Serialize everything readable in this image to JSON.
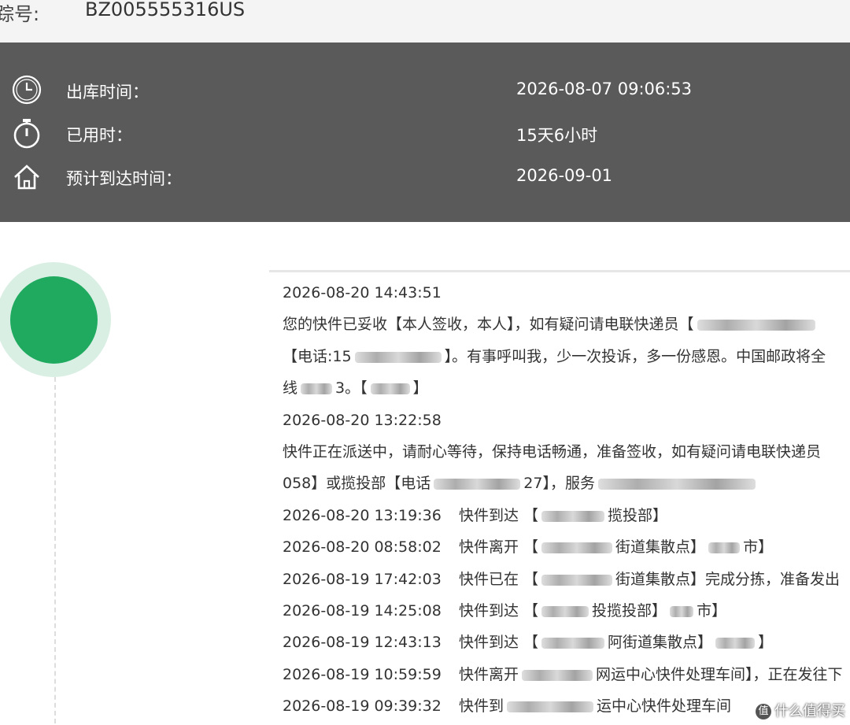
{
  "header": {
    "tracking_label": "踪号:",
    "tracking_number": "BZ005555316US"
  },
  "summary": {
    "rows": [
      {
        "icon": "clock-icon",
        "label": "出库时间：",
        "value": "2026-08-07 09:06:53"
      },
      {
        "icon": "stopwatch-icon",
        "label": "已用时：",
        "value": "15天6小时"
      },
      {
        "icon": "home-icon",
        "label": "预计到达时间：",
        "value": "2026-09-01"
      }
    ]
  },
  "timeline": {
    "entries": [
      {
        "time": "2026-08-20 14:43:51",
        "text": ""
      },
      {
        "time": "",
        "text": "您的快件已妥收【本人签收，本人】，如有疑问请电联快递员【"
      },
      {
        "time": "",
        "text": "【电话:15"
      },
      {
        "time": "",
        "text": "线"
      },
      {
        "time": "2026-08-20 13:22:58",
        "text": ""
      },
      {
        "time": "",
        "text": "快件正在派送中，请耐心等待，保持电话畅通，准备签收，如有疑问请电联快递员"
      },
      {
        "time": "",
        "text": "058】或揽投部【电话"
      },
      {
        "time": "2026-08-20 13:19:36",
        "text": "快件到达 【"
      },
      {
        "time": "2026-08-20 08:58:02",
        "text": "快件离开 【"
      },
      {
        "time": "2026-08-19 17:42:03",
        "text": "快件已在 【"
      },
      {
        "time": "2026-08-19 14:25:08",
        "text": "快件到达 【"
      },
      {
        "time": "2026-08-19 12:43:13",
        "text": "快件到达 【"
      },
      {
        "time": "2026-08-19 10:59:59",
        "text": "快件离开"
      },
      {
        "time": "2026-08-19 09:39:32",
        "text": "快件到"
      }
    ],
    "fragments": {
      "l2_tail": "】。有事呼叫我，少一次投诉，多一份感恩。中国邮政将全",
      "l3_mid": "3。【",
      "l3_end": "】",
      "l6_mid": "27】，服务",
      "l7_tail": "揽投部】",
      "l8_tail": "街道集散点】",
      "l8_end": "市】",
      "l9_tail": "街道集散点】完成分拣，准备发出",
      "l10_tail": "投揽投部】",
      "l10_end": "市】",
      "l11_tail": "阿街道集散点】",
      "l11_end": "】",
      "l12_tail": "网运中心快件处理车间】，正在发往下",
      "l13_tail": "运中心快件处理车间"
    }
  },
  "watermark": {
    "mark": "值",
    "text": "什么值得买"
  }
}
